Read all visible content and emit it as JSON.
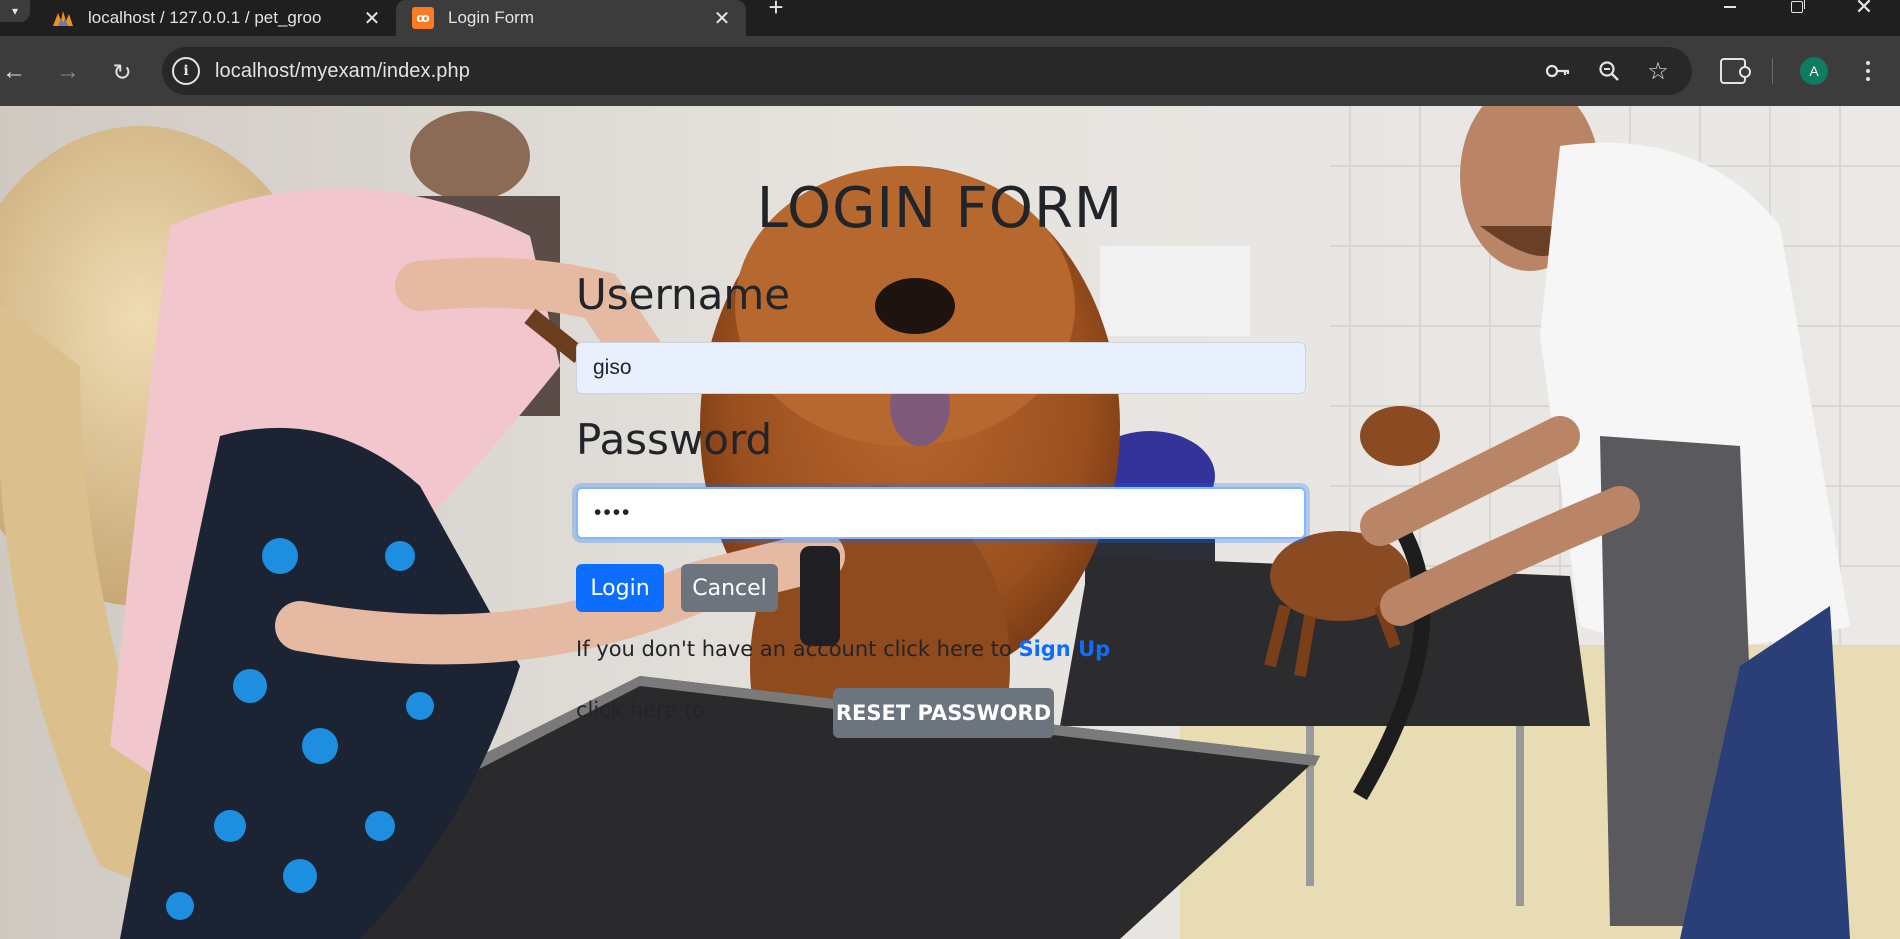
{
  "browser": {
    "tabs": [
      {
        "title": "localhost / 127.0.0.1 / pet_groo",
        "favicon": "phpmyadmin-icon",
        "active": false
      },
      {
        "title": "Login Form",
        "favicon": "xampp-icon",
        "active": true
      }
    ],
    "url": "localhost/myexam/index.php",
    "profile_initial": "A"
  },
  "page": {
    "title": "LOGIN FORM",
    "username_label": "Username",
    "username_value": "giso",
    "password_label": "Password",
    "password_value": "••••",
    "login_label": "Login",
    "cancel_label": "Cancel",
    "signup_prefix": "If you don't have an account click here to",
    "signup_link": "Sign Up",
    "reset_prefix": "click here to",
    "reset_label": "RESET PASSWORD"
  },
  "colors": {
    "primary": "#0d6efd",
    "secondary": "#6c757d",
    "text": "#212529",
    "tab_strip": "#1f1f1f",
    "toolbar": "#3c3c3c"
  }
}
